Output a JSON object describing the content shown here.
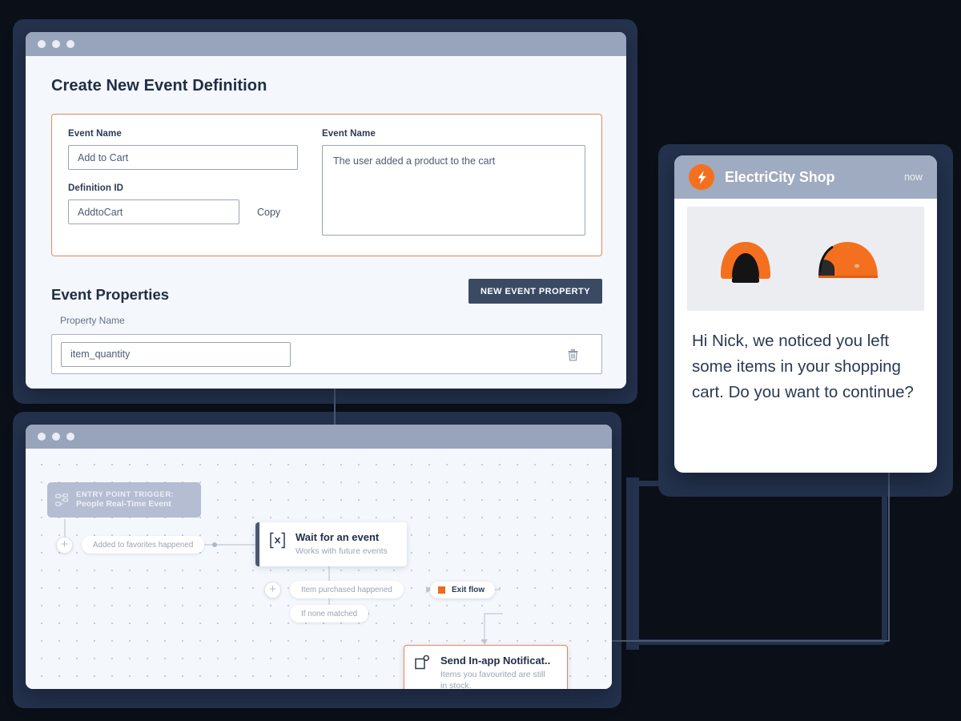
{
  "colors": {
    "backdrop": "#0b0f18",
    "navy_plate": "#24324d",
    "titlebar": "#98a4bb",
    "accent_orange": "#e4875c",
    "brand_orange": "#f4701f",
    "exit_orange": "#ea6c1f",
    "btn_dark": "#3b4a63",
    "canvas_bg": "#f4f7fc"
  },
  "event_window": {
    "titlebar_dots": 3,
    "page_title": "Create New Event Definition",
    "definition_card": {
      "event_name_label": "Event Name",
      "event_name_value": "Add to Cart",
      "definition_id_label": "Definition ID",
      "definition_id_value": "AddtoCart",
      "copy_label": "Copy",
      "description_label": "Event Name",
      "description_value": "The user added a product to the cart"
    },
    "properties": {
      "title": "Event Properties",
      "new_button_label": "NEW EVENT PROPERTY",
      "column_header": "Property Name",
      "rows": [
        {
          "name": "item_quantity",
          "delete_icon": "trash-icon"
        }
      ]
    }
  },
  "flow_window": {
    "titlebar_dots": 3,
    "trigger": {
      "icon": "sitemap-icon",
      "line1": "ENTRY POINT TRIGGER:",
      "line2": "People Real-Time Event"
    },
    "branch_pills": [
      "Added to favorites happened",
      "Item purchased happened",
      "If none matched"
    ],
    "nodes": [
      {
        "id": "wait-for-event",
        "icon": "bracket-x-icon",
        "title": "Wait for an event",
        "subtitle": "Works with future events"
      },
      {
        "id": "send-in-app-notification",
        "icon": "notification-icon",
        "title": "Send In-app Notificat..",
        "subtitle": "Items you favourited are still in stock."
      }
    ],
    "exit_flow": {
      "label": "Exit flow",
      "marker_color": "#ea6c1f"
    },
    "add_buttons": [
      "+",
      "+"
    ]
  },
  "notification": {
    "brand_icon": "lightning-bolt-icon",
    "brand_name": "ElectriCity Shop",
    "timestamp": "now",
    "hero_image_alt": "two-orange-open-face-helmets",
    "message": "Hi Nick, we noticed you left some items in your shopping cart. Do you want to continue?"
  }
}
